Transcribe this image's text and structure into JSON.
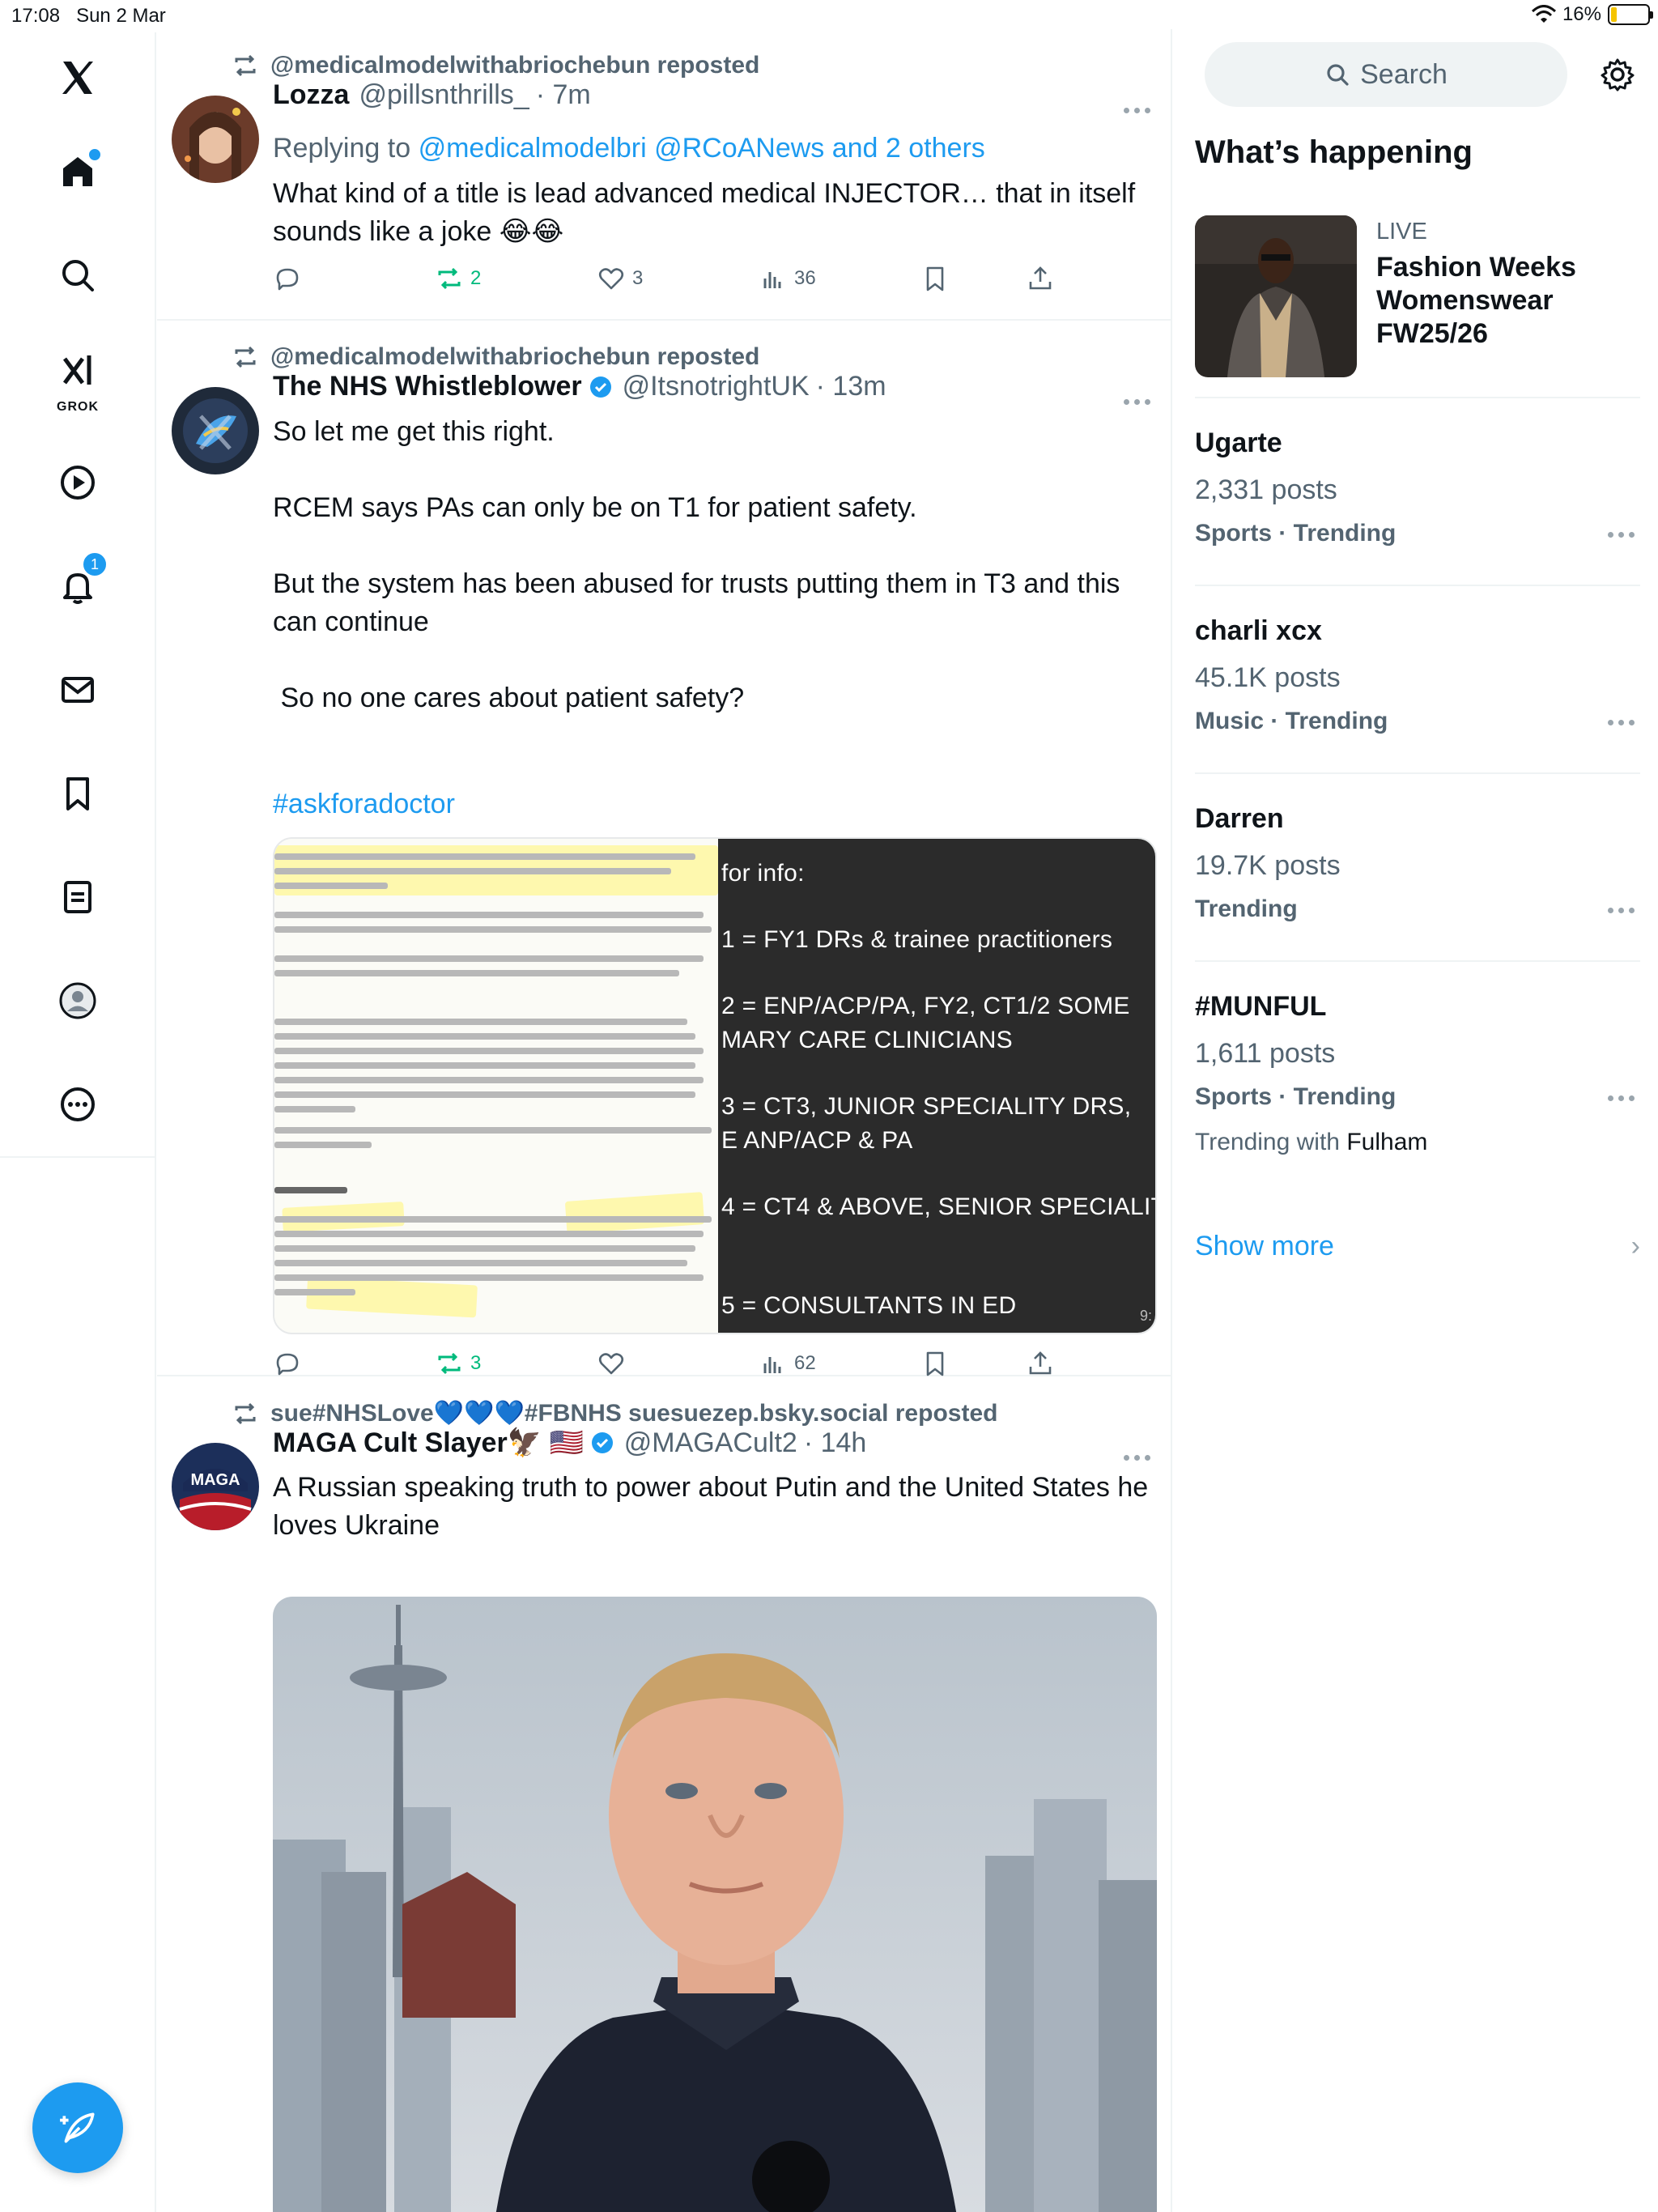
{
  "status_bar": {
    "time": "17:08",
    "date": "Sun 2 Mar",
    "battery": "16%",
    "battery_level": 0.16
  },
  "nav": {
    "grok_label": "GROK",
    "notifications_badge": "1"
  },
  "tweets": [
    {
      "reposted_by": "@medicalmodelwithabriochebun reposted",
      "name": "Lozza",
      "handle": "@pillsnthrills_",
      "time": "· 7m",
      "reply_prefix": "Replying to",
      "reply_targets": "@medicalmodelbri @RCoANews and 2 others",
      "text": "What kind of a title is lead advanced medical INJECTOR… that in itself sounds like a joke 😂😂",
      "reposts": "2",
      "likes": "3",
      "views": "36"
    },
    {
      "reposted_by": "@medicalmodelwithabriochebun reposted",
      "name": "The NHS Whistleblower",
      "handle": "@ItsnotrightUK",
      "time": "· 13m",
      "text": "So let me get this right.\n\nRCEM says PAs can only be on T1 for patient safety.\n\nBut the system has been abused for trusts putting them in T3 and this can continue\n\n So no one cares about patient safety?",
      "hashtag": "#askforadoctor",
      "media_lines": [
        "for info:",
        "1 = FY1 DRs & trainee practitioners",
        "2 = ENP/ACP/PA, FY2, CT1/2 SOME",
        "MARY CARE CLINICIANS",
        "3 = CT3, JUNIOR SPECIALITY DRS,",
        "E ANP/ACP & PA",
        "4 = CT4 & ABOVE, SENIOR SPECIALIT",
        "5 = CONSULTANTS IN ED"
      ],
      "media_duration": "9:",
      "reposts": "3",
      "likes": "",
      "views": "62"
    },
    {
      "reposted_by": "sue#NHSLove💙💙💙#FBNHS suesuezep.bsky.social reposted",
      "name": "MAGA Cult Slayer🦅 🇺🇸",
      "handle": "@MAGACult2",
      "time": "· 14h",
      "text": "A Russian speaking truth to power about Putin and the United States he loves Ukraine"
    }
  ],
  "right": {
    "search_placeholder": "Search",
    "whats_happening": "What’s happening",
    "live": {
      "label": "LIVE",
      "headline": "Fashion Weeks Womenswear FW25/26"
    },
    "trends": [
      {
        "name": "Ugarte",
        "count": "2,331 posts",
        "category": "Sports · Trending",
        "with": ""
      },
      {
        "name": "charli xcx",
        "count": "45.1K posts",
        "category": "Music · Trending",
        "with": ""
      },
      {
        "name": "Darren",
        "count": "19.7K posts",
        "category": "Trending",
        "with": ""
      },
      {
        "name": "#MUNFUL",
        "count": "1,611 posts",
        "category": "Sports · Trending",
        "with_prefix": "Trending with",
        "with": "Fulham"
      }
    ],
    "show_more": "Show more"
  },
  "colors": {
    "accent": "#1d9bf0",
    "repost_green": "#00ba7c",
    "muted": "#536471"
  }
}
